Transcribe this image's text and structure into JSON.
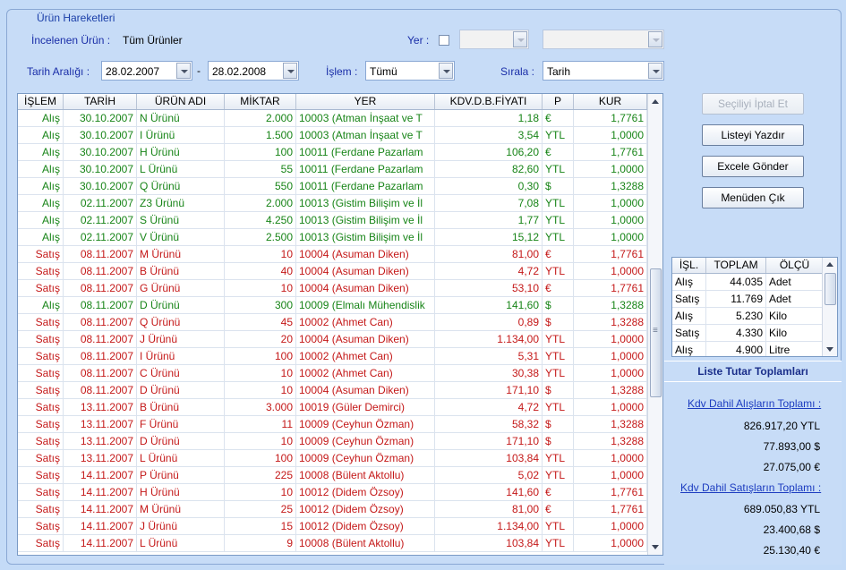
{
  "frame_title": "Ürün Hareketleri",
  "filters": {
    "incelenen_label": "İncelenen Ürün :",
    "incelenen_value": "Tüm Ürünler",
    "yer_label": "Yer :",
    "tarih_label": "Tarih Aralığı :",
    "date_from": "28.02.2007",
    "date_sep": "-",
    "date_to": "28.02.2008",
    "islem_label": "İşlem :",
    "islem_value": "Tümü",
    "sirala_label": "Sırala :",
    "sirala_value": "Tarih"
  },
  "grid": {
    "columns": [
      "İŞLEM",
      "TARİH",
      "ÜRÜN ADI",
      "MİKTAR",
      "YER",
      "KDV.D.B.FİYATI",
      "P",
      "KUR"
    ],
    "rows": [
      [
        "Alış",
        "30.10.2007",
        "N Ürünü",
        "2.000",
        "10003 (Atman İnşaat ve T",
        "1,18",
        "€",
        "1,7761"
      ],
      [
        "Alış",
        "30.10.2007",
        "I Ürünü",
        "1.500",
        "10003 (Atman İnşaat ve T",
        "3,54",
        "YTL",
        "1,0000"
      ],
      [
        "Alış",
        "30.10.2007",
        "H Ürünü",
        "100",
        "10011 (Ferdane Pazarlam",
        "106,20",
        "€",
        "1,7761"
      ],
      [
        "Alış",
        "30.10.2007",
        "L Ürünü",
        "55",
        "10011 (Ferdane Pazarlam",
        "82,60",
        "YTL",
        "1,0000"
      ],
      [
        "Alış",
        "30.10.2007",
        "Q Ürünü",
        "550",
        "10011 (Ferdane Pazarlam",
        "0,30",
        "$",
        "1,3288"
      ],
      [
        "Alış",
        "02.11.2007",
        "Z3 Ürünü",
        "2.000",
        "10013 (Gistim Bilişim ve İl",
        "7,08",
        "YTL",
        "1,0000"
      ],
      [
        "Alış",
        "02.11.2007",
        "S Ürünü",
        "4.250",
        "10013 (Gistim Bilişim ve İl",
        "1,77",
        "YTL",
        "1,0000"
      ],
      [
        "Alış",
        "02.11.2007",
        "V Ürünü",
        "2.500",
        "10013 (Gistim Bilişim ve İl",
        "15,12",
        "YTL",
        "1,0000"
      ],
      [
        "Satış",
        "08.11.2007",
        "M Ürünü",
        "10",
        "10004 (Asuman Diken)",
        "81,00",
        "€",
        "1,7761"
      ],
      [
        "Satış",
        "08.11.2007",
        "B Ürünü",
        "40",
        "10004 (Asuman Diken)",
        "4,72",
        "YTL",
        "1,0000"
      ],
      [
        "Satış",
        "08.11.2007",
        "G Ürünü",
        "10",
        "10004 (Asuman Diken)",
        "53,10",
        "€",
        "1,7761"
      ],
      [
        "Alış",
        "08.11.2007",
        "D Ürünü",
        "300",
        "10009 (Elmalı Mühendislik",
        "141,60",
        "$",
        "1,3288"
      ],
      [
        "Satış",
        "08.11.2007",
        "Q Ürünü",
        "45",
        "10002 (Ahmet Can)",
        "0,89",
        "$",
        "1,3288"
      ],
      [
        "Satış",
        "08.11.2007",
        "J Ürünü",
        "20",
        "10004 (Asuman Diken)",
        "1.134,00",
        "YTL",
        "1,0000"
      ],
      [
        "Satış",
        "08.11.2007",
        "I Ürünü",
        "100",
        "10002 (Ahmet Can)",
        "5,31",
        "YTL",
        "1,0000"
      ],
      [
        "Satış",
        "08.11.2007",
        "C Ürünü",
        "10",
        "10002 (Ahmet Can)",
        "30,38",
        "YTL",
        "1,0000"
      ],
      [
        "Satış",
        "08.11.2007",
        "D Ürünü",
        "10",
        "10004 (Asuman Diken)",
        "171,10",
        "$",
        "1,3288"
      ],
      [
        "Satış",
        "13.11.2007",
        "B Ürünü",
        "3.000",
        "10019 (Güler Demirci)",
        "4,72",
        "YTL",
        "1,0000"
      ],
      [
        "Satış",
        "13.11.2007",
        "F Ürünü",
        "11",
        "10009 (Ceyhun Özman)",
        "58,32",
        "$",
        "1,3288"
      ],
      [
        "Satış",
        "13.11.2007",
        "D Ürünü",
        "10",
        "10009 (Ceyhun Özman)",
        "171,10",
        "$",
        "1,3288"
      ],
      [
        "Satış",
        "13.11.2007",
        "L Ürünü",
        "100",
        "10009 (Ceyhun Özman)",
        "103,84",
        "YTL",
        "1,0000"
      ],
      [
        "Satış",
        "14.11.2007",
        "P Ürünü",
        "225",
        "10008 (Bülent Aktollu)",
        "5,02",
        "YTL",
        "1,0000"
      ],
      [
        "Satış",
        "14.11.2007",
        "H Ürünü",
        "10",
        "10012 (Didem Özsoy)",
        "141,60",
        "€",
        "1,7761"
      ],
      [
        "Satış",
        "14.11.2007",
        "M Ürünü",
        "25",
        "10012 (Didem Özsoy)",
        "81,00",
        "€",
        "1,7761"
      ],
      [
        "Satış",
        "14.11.2007",
        "J Ürünü",
        "15",
        "10012 (Didem Özsoy)",
        "1.134,00",
        "YTL",
        "1,0000"
      ],
      [
        "Satış",
        "14.11.2007",
        "L Ürünü",
        "9",
        "10008 (Bülent Aktollu)",
        "103,84",
        "YTL",
        "1,0000"
      ]
    ],
    "scroll_thumb_top_fraction": 0.37,
    "scroll_thumb_size_fraction": 0.15
  },
  "buttons": {
    "iptal": "Seçiliyi İptal Et",
    "yazdir": "Listeyi Yazdır",
    "excel": "Excele Gönder",
    "cik": "Menüden Çık"
  },
  "summary": {
    "columns": [
      "İŞL.",
      "TOPLAM",
      "ÖLÇÜ"
    ],
    "rows": [
      [
        "Alış",
        "44.035",
        "Adet"
      ],
      [
        "Satış",
        "11.769",
        "Adet"
      ],
      [
        "Alış",
        "5.230",
        "Kilo"
      ],
      [
        "Satış",
        "4.330",
        "Kilo"
      ],
      [
        "Alış",
        "4.900",
        "Litre"
      ]
    ]
  },
  "totals": {
    "title": "Liste Tutar Toplamları",
    "alis_link": "Kdv Dahil Alışların Toplamı :",
    "alis_values": [
      "826.917,20 YTL",
      "77.893,00 $",
      "27.075,00 €"
    ],
    "satis_link": "Kdv Dahil Satışların Toplamı :",
    "satis_values": [
      "689.050,83 YTL",
      "23.400,68 $",
      "25.130,40 €"
    ]
  },
  "colors": {
    "alis": "#178417",
    "satis": "#c41818",
    "background": "#c4dbf7",
    "label": "#1a2ea8"
  }
}
